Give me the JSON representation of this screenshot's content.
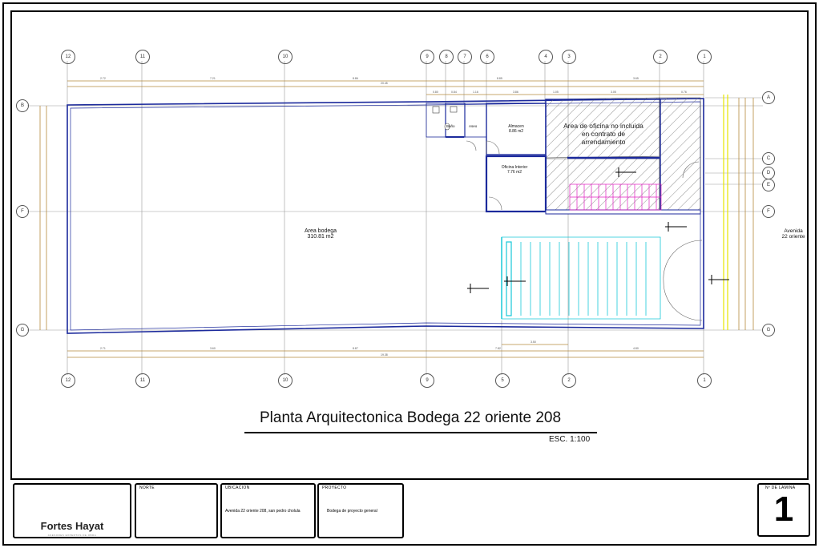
{
  "title": "Planta Arquitectonica Bodega 22 oriente 208",
  "scale": "ESC. 1:100",
  "rooms": {
    "bodega": {
      "name": "Area bodega",
      "area": "310.81 m2"
    },
    "almacen": {
      "name": "Almacen",
      "area": "8.86 m2"
    },
    "oficina": {
      "name": "Oficina Interior",
      "area": "7.76 m2"
    },
    "bano": "Baño",
    "aseo": "Aseo",
    "area_oficina_lines": [
      "Area de oficina no incluida",
      "en contrato de",
      "arrendamiento"
    ]
  },
  "street": {
    "line1": "Avenida",
    "line2": "22 oriente"
  },
  "axes_vertical": [
    "12",
    "11",
    "10",
    "9",
    "8",
    "7",
    "6",
    "4",
    "3",
    "2",
    "1"
  ],
  "axes_horizontal": [
    "A",
    "B",
    "C",
    "D",
    "E",
    "F",
    "G"
  ],
  "title_block": {
    "logo_name": "Fortes Hayat",
    "logo_tagline": "ASESORES EXPERTOS DE OBRA",
    "norte_label": "NORTE",
    "ubicacion_label": "UBICACION",
    "ubicacion_value": "Avenida 22 oriente 208, san pedro cholula",
    "proyecto_label": "PROYECTO",
    "proyecto_value": "Bodega de proyecto general",
    "lamina_label": "Nº DE LAMINA",
    "lamina_value": "1"
  },
  "colors": {
    "walls": "#1c2a9c",
    "dims": "#b58a3c",
    "stairs": "#e020c0",
    "ramp": "#18c8d8",
    "hatch": "#666666",
    "yellow": "#e6e600",
    "gridline": "#9a9a9a"
  }
}
